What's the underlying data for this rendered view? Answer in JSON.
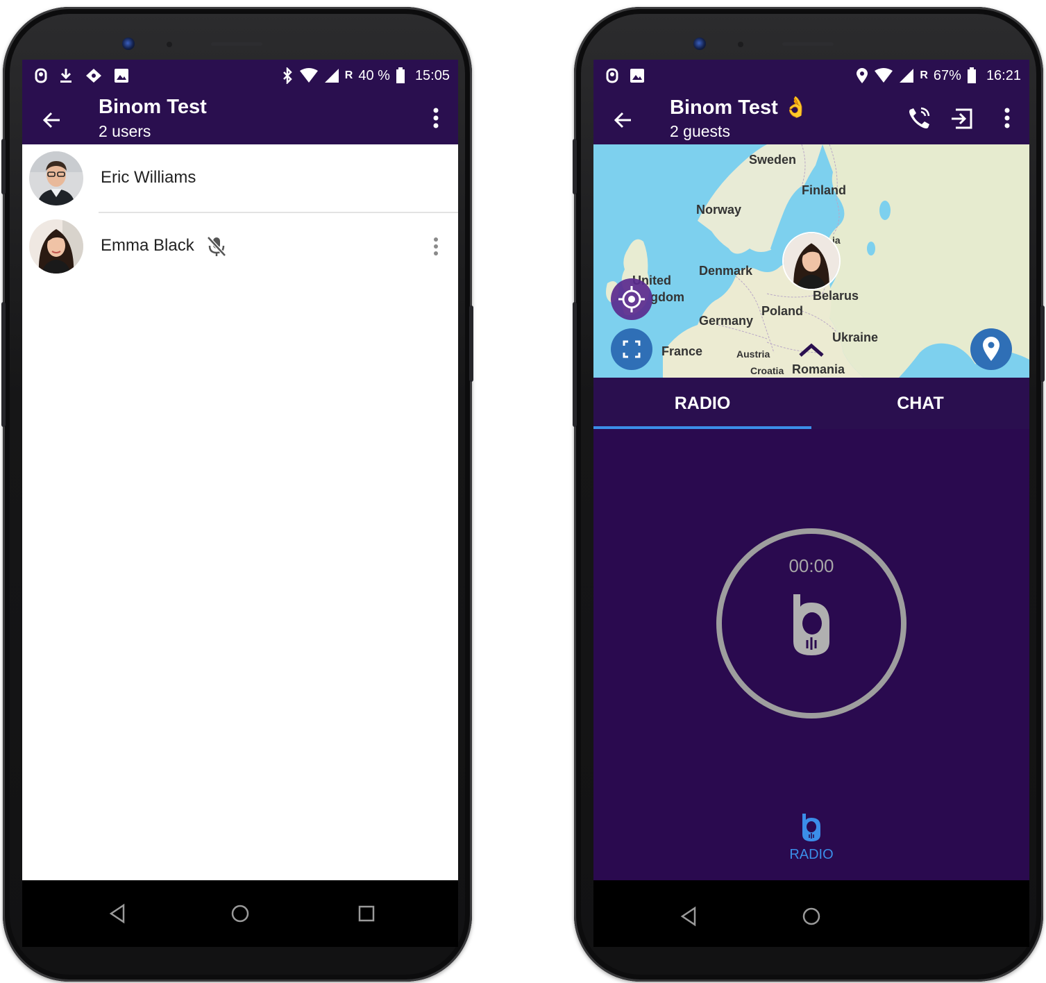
{
  "left_screen": {
    "status_bar": {
      "battery": "40 %",
      "time": "15:05",
      "roaming": "R"
    },
    "header": {
      "title": "Binom Test",
      "subtitle": "2 users"
    },
    "members": [
      {
        "name": "Eric Williams"
      },
      {
        "name": "Emma Black",
        "status_icon": "mic-off-icon"
      }
    ]
  },
  "right_screen": {
    "status_bar": {
      "battery": "67%",
      "time": "16:21",
      "roaming": "R"
    },
    "header": {
      "title": "Binom Test",
      "emoji": "👌",
      "subtitle": "2 guests"
    },
    "map": {
      "labels": {
        "sweden": "Sweden",
        "finland": "Finland",
        "norway": "Norway",
        "denmark": "Denmark",
        "united": "United",
        "kingdom": "gdom",
        "belarus": "Belarus",
        "poland": "Poland",
        "germany": "Germany",
        "ukraine": "Ukraine",
        "france": "France",
        "austria": "Austria",
        "croatia": "Croatia",
        "romania": "Romania",
        "latvia_partial": "ia"
      }
    },
    "tabs": [
      {
        "label": "RADIO"
      },
      {
        "label": "CHAT"
      }
    ],
    "radio": {
      "timer": "00:00",
      "bottom_label": "RADIO"
    }
  },
  "colors": {
    "primary": "#2a0f4f",
    "accent": "#3b8ee8",
    "radio_bg": "#2a0a4f",
    "ring": "#9e9e9e"
  }
}
